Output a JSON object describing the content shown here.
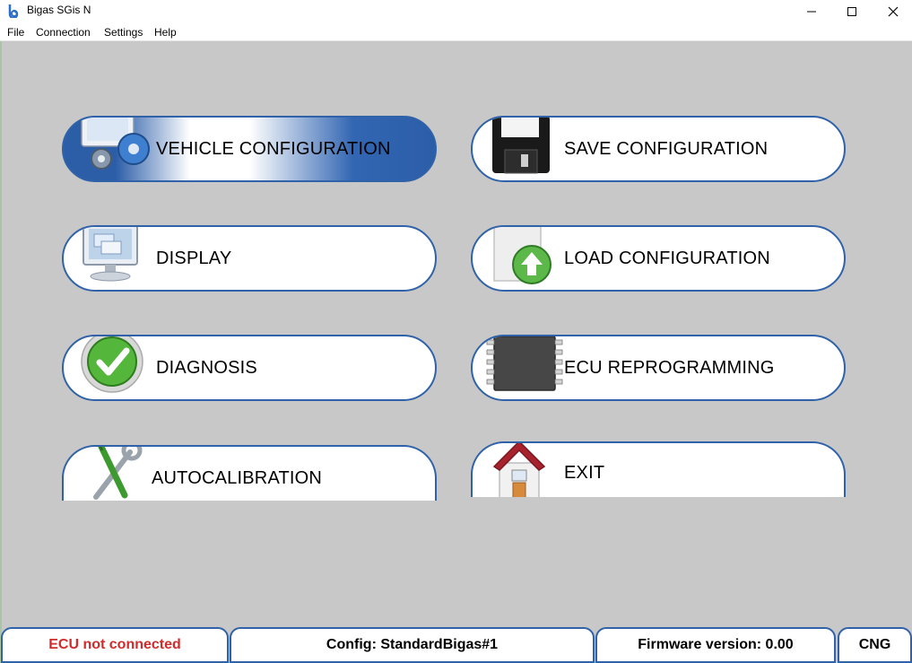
{
  "window": {
    "title": "Bigas SGis N",
    "icon": "bigas-logo-icon"
  },
  "menu": [
    "File",
    "Connection",
    "Settings",
    "Help"
  ],
  "buttons": [
    {
      "label": "VEHICLE CONFIGURATION",
      "icon": "config-gears-icon"
    },
    {
      "label": "SAVE CONFIGURATION",
      "icon": "floppy-disk-icon"
    },
    {
      "label": "DISPLAY",
      "icon": "monitor-icon"
    },
    {
      "label": "LOAD CONFIGURATION",
      "icon": "document-upload-icon"
    },
    {
      "label": "DIAGNOSIS",
      "icon": "checkmark-icon"
    },
    {
      "label": "ECU REPROGRAMMING",
      "icon": "chip-icon"
    },
    {
      "label": "AUTOCALIBRATION",
      "icon": "tools-icon"
    },
    {
      "label": "EXIT",
      "icon": "house-icon"
    }
  ],
  "status": {
    "ecu": "ECU not connected",
    "config": "Config: StandardBigas#1",
    "firmware": "Firmware version: 0.00",
    "fuel": "CNG"
  },
  "colors": {
    "accent": "#2f62a8",
    "background": "#c8c8c8",
    "error": "#d22b2b"
  }
}
